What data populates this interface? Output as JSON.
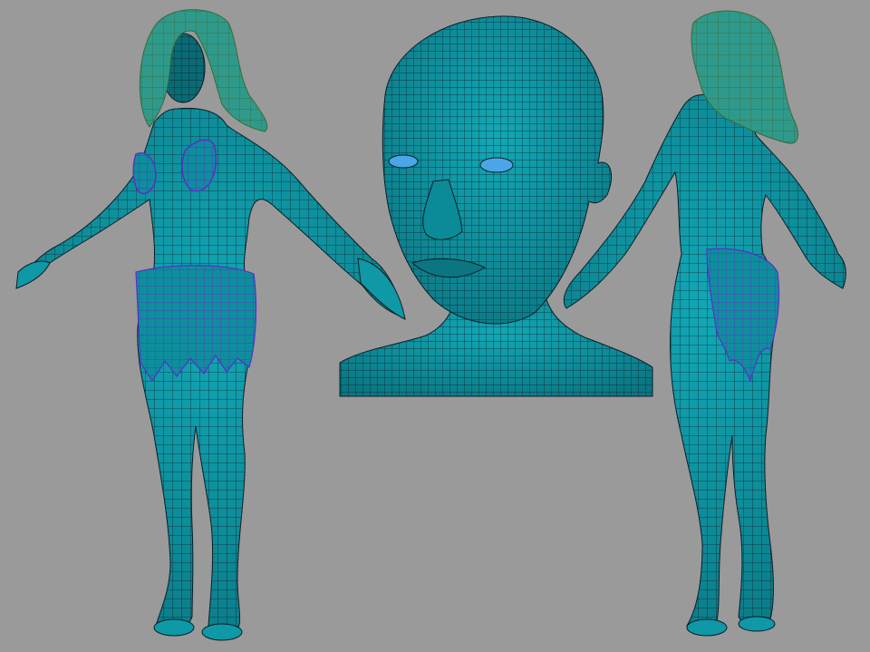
{
  "scene": {
    "views": [
      {
        "id": "front",
        "label_key": "front-three-quarter-view"
      },
      {
        "id": "head",
        "label_key": "head-closeup-view"
      },
      {
        "id": "back",
        "label_key": "back-three-quarter-view"
      }
    ]
  },
  "colors": {
    "background": "#9a9a9a",
    "mesh_fill": "#0f98a6",
    "mesh_fill_dark": "#0a7682",
    "wire": "#0b1d26",
    "hair_fill": "#2f9a8c",
    "hair_wire": "#3a6a36",
    "cloth_wire": "#5a2fc8",
    "eye": "#4aa6e6"
  }
}
